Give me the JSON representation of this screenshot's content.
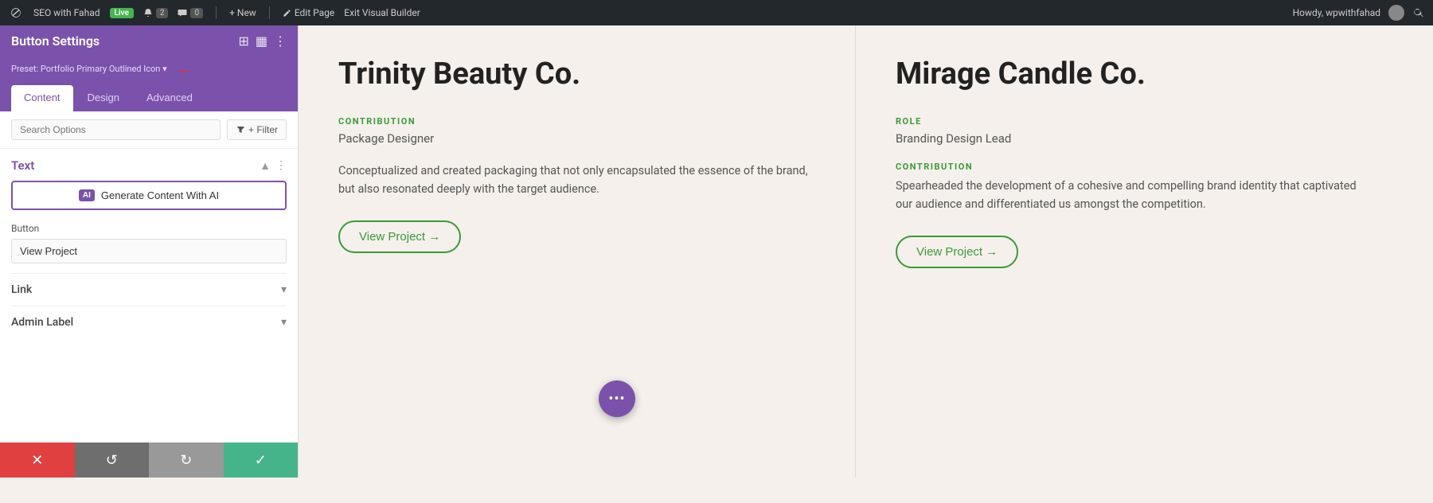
{
  "topbar": {
    "wp_label": "W",
    "site_name": "SEO with Fahad",
    "live_label": "Live",
    "counter1": "2",
    "counter2": "0",
    "new_label": "+ New",
    "edit_label": "Edit Page",
    "exit_label": "Exit Visual Builder",
    "user_label": "Howdy, wpwithfahad"
  },
  "sidebar": {
    "title": "Button Settings",
    "preset_label": "Preset: Portfolio Primary Outlined Icon",
    "tabs": [
      "Content",
      "Design",
      "Advanced"
    ],
    "active_tab": "Content",
    "search_placeholder": "Search Options",
    "filter_label": "+ Filter",
    "text_section": {
      "title": "Text",
      "ai_button_label": "Generate Content With AI"
    },
    "button_section": {
      "label": "Button",
      "value": "View Project"
    },
    "link_section": {
      "title": "Link"
    },
    "admin_section": {
      "title": "Admin Label"
    },
    "toolbar": {
      "cancel": "✕",
      "undo": "↺",
      "redo": "↻",
      "save": "✓"
    }
  },
  "cards": [
    {
      "title": "Trinity Beauty Co.",
      "role_label": "",
      "role": "Package Designer",
      "contribution_label": "CONTRIBUTION",
      "contribution_text": "Conceptualized and created packaging that not only encapsulated the essence of the brand, but also resonated deeply with the target audience.",
      "btn_label": "View Project →"
    },
    {
      "title": "Mirage Candle Co.",
      "role_label": "ROLE",
      "role": "Branding Design Lead",
      "contribution_label": "CONTRIBUTION",
      "contribution_text": "Spearheaded the development of a cohesive and compelling brand identity that captivated our audience and differentiated us amongst the competition.",
      "btn_label": "View Project →"
    }
  ],
  "fab": {
    "dots": "•••"
  }
}
